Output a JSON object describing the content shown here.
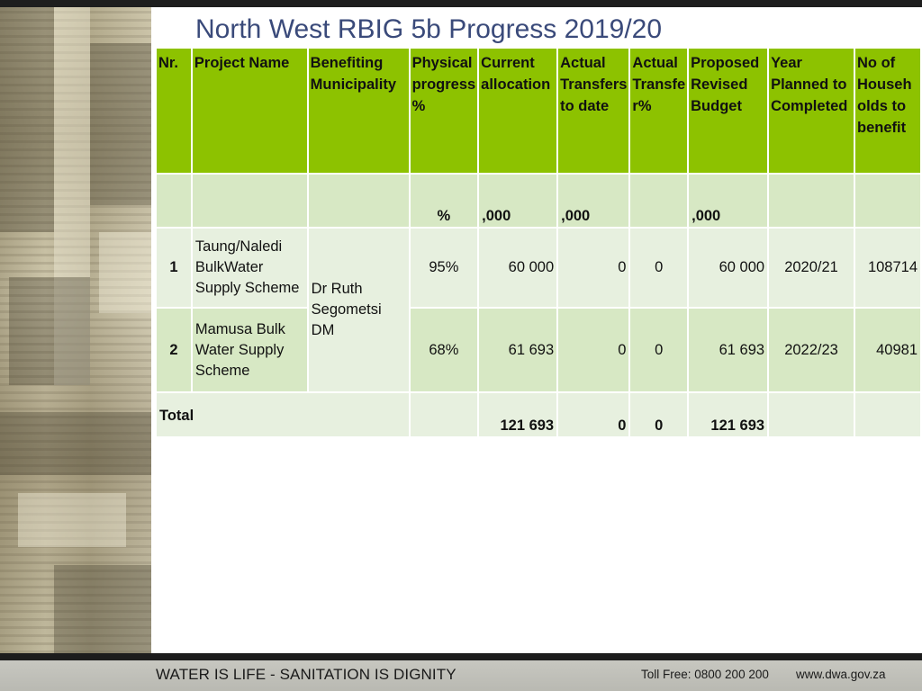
{
  "title": "North West RBIG 5b Progress 2019/20",
  "headers": {
    "nr": "Nr.",
    "project_name": "Project Name",
    "benefiting_municipality": "Benefiting Municipality",
    "physical_progress": "Physical progress %",
    "current_allocation": "Current allocation",
    "actual_transfers": "Actual Transfers to date",
    "actual_transfer_pct": "Actual Transfe r%",
    "proposed_revised_budget": "Proposed Revised Budget",
    "year_planned": "Year Planned to Completed",
    "no_households": "No of Househ olds to benefit"
  },
  "units": {
    "physical_progress": "%",
    "current_allocation": ",000",
    "actual_transfers": ",000",
    "proposed_revised_budget": ",000"
  },
  "shared_municipality": "Dr Ruth Segometsi DM",
  "rows": [
    {
      "nr": "1",
      "project_name": "Taung/Naledi BulkWater Supply Scheme",
      "physical_progress": "95%",
      "current_allocation": "60 000",
      "actual_transfers": "0",
      "actual_transfer_pct": "0",
      "proposed_revised_budget": "60 000",
      "year_planned": "2020/21",
      "no_households": "108714"
    },
    {
      "nr": "2",
      "project_name": "Mamusa Bulk Water Supply Scheme",
      "physical_progress": "68%",
      "current_allocation": "61 693",
      "actual_transfers": "0",
      "actual_transfer_pct": "0",
      "proposed_revised_budget": "61 693",
      "year_planned": "2022/23",
      "no_households": "40981"
    }
  ],
  "total": {
    "label": "Total",
    "current_allocation": "121 693",
    "actual_transfers": "0",
    "actual_transfer_pct": "0",
    "proposed_revised_budget": "121 693"
  },
  "footer": {
    "slogan": "WATER IS LIFE - SANITATION IS DIGNITY",
    "toll_free": "Toll Free: 0800 200 200",
    "website": "www.dwa.gov.za"
  },
  "colors": {
    "header_green": "#8dc200",
    "row_light": "#e7f0df",
    "row_mid": "#d7e8c4",
    "title_blue": "#3a4a7a"
  }
}
